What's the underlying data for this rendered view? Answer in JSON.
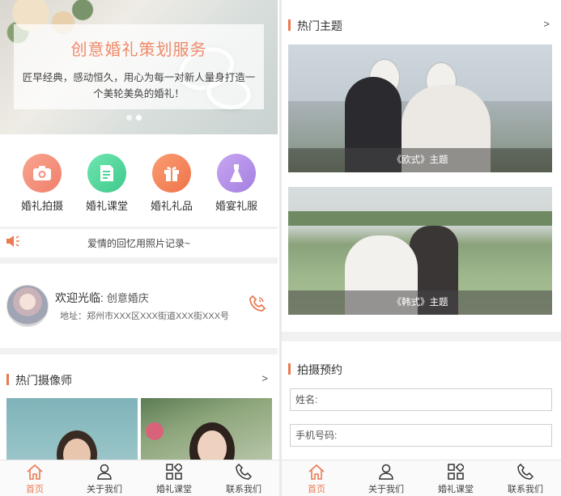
{
  "left": {
    "banner": {
      "title": "创意婚礼策划服务",
      "description": "匠早经典，感动恒久，用心为每一对新人量身打造一个美轮美奂的婚礼！"
    },
    "categories": [
      {
        "label": "婚礼拍摄",
        "icon": "camera-icon",
        "color": "#f38f7a"
      },
      {
        "label": "婚礼课堂",
        "icon": "note-icon",
        "color": "#4fd49a"
      },
      {
        "label": "婚礼礼品",
        "icon": "gift-icon",
        "color": "#f5875a"
      },
      {
        "label": "婚宴礼服",
        "icon": "dress-icon",
        "color": "#b392e6"
      }
    ],
    "notice": {
      "text": "爱情的回忆用照片记录~"
    },
    "welcome": {
      "greeting": "欢迎光临:",
      "name": "创意婚庆",
      "address": "地址：郑州市XXX区XXX街道XXX街XXX号"
    },
    "photographers": {
      "title": "热门摄像师",
      "more": ">"
    }
  },
  "right": {
    "themes": {
      "title": "热门主题",
      "more": ">",
      "items": [
        {
          "caption": "《欧式》主题"
        },
        {
          "caption": "《韩式》主题"
        }
      ]
    },
    "booking": {
      "title": "拍摄预约",
      "name_placeholder": "姓名:",
      "phone_placeholder": "手机号码:"
    }
  },
  "tabbar": [
    {
      "label": "首页",
      "icon": "home-icon"
    },
    {
      "label": "关于我们",
      "icon": "user-icon"
    },
    {
      "label": "婚礼课堂",
      "icon": "grid-icon"
    },
    {
      "label": "联系我们",
      "icon": "phone-icon"
    }
  ],
  "colors": {
    "accent": "#e97a52",
    "divider": "#f1f1f1"
  }
}
